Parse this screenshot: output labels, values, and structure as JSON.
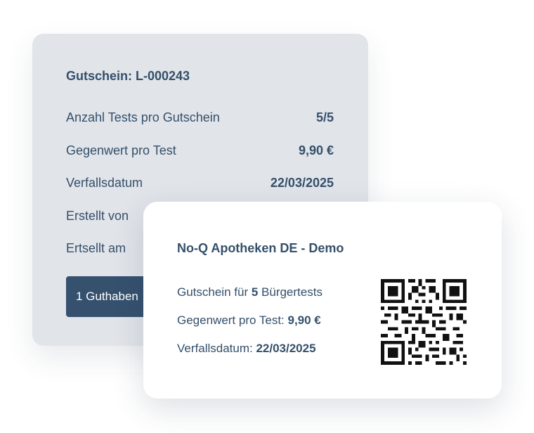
{
  "voucher": {
    "title": "Gutschein: L-000243",
    "rows": [
      {
        "label": "Anzahl Tests pro Gutschein",
        "value": "5/5"
      },
      {
        "label": "Gegenwert pro Test",
        "value": "9,90 €"
      },
      {
        "label": "Verfallsdatum",
        "value": "22/03/2025"
      },
      {
        "label": "Erstellt von",
        "value": ""
      },
      {
        "label": "Ertsellt am",
        "value": ""
      }
    ],
    "button_label": "1 Guthaben"
  },
  "coupon": {
    "pharmacy": "No-Q Apotheken DE - Demo",
    "line1_prefix": "Gutschein für ",
    "line1_count": "5",
    "line1_suffix": " Bürgertests",
    "line2_prefix": "Gegenwert pro Test: ",
    "line2_value": "9,90 €",
    "line3_prefix": "Verfallsdatum: ",
    "line3_value": "22/03/2025",
    "qr_icon": "qr-code-icon"
  },
  "colors": {
    "back_card": "#e1e4e9",
    "text": "#34506b",
    "button": "#35516e",
    "front_card": "#ffffff"
  }
}
